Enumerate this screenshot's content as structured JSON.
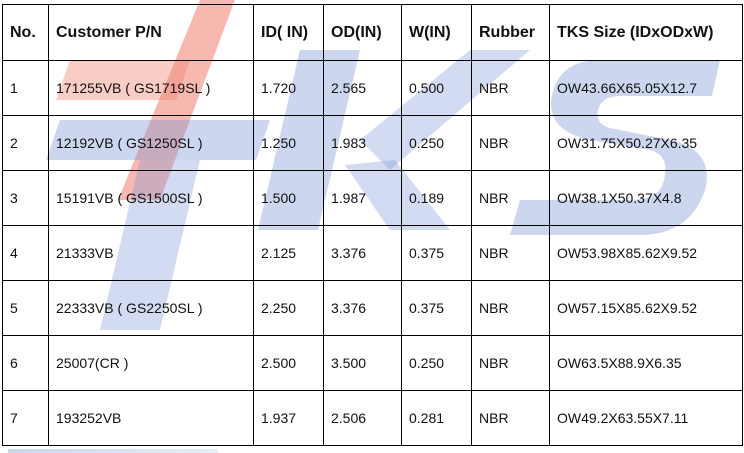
{
  "watermark": {
    "text": "TKS",
    "color_red": "#f07f6e",
    "color_blue": "#7f98d8"
  },
  "table": {
    "headers": [
      "No.",
      "Customer P/N",
      "ID( IN)",
      "OD(IN)",
      "W(IN)",
      "Rubber",
      "TKS Size (IDxODxW)"
    ],
    "rows": [
      [
        "1",
        "171255VB ( GS1719SL )",
        "1.720",
        "2.565",
        "0.500",
        "NBR",
        "OW43.66X65.05X12.7"
      ],
      [
        "2",
        "12192VB ( GS1250SL )",
        "1.250",
        "1.983",
        "0.250",
        "NBR",
        "OW31.75X50.27X6.35"
      ],
      [
        "3",
        "15191VB ( GS1500SL )",
        "1.500",
        "1.987",
        "0.189",
        "NBR",
        "OW38.1X50.37X4.8"
      ],
      [
        "4",
        "21333VB",
        "2.125",
        "3.376",
        "0.375",
        "NBR",
        "OW53.98X85.62X9.52"
      ],
      [
        "5",
        "22333VB ( GS2250SL )",
        "2.250",
        "3.376",
        "0.375",
        "NBR",
        "OW57.15X85.62X9.52"
      ],
      [
        "6",
        "25007(CR )",
        "2.500",
        "3.500",
        "0.250",
        "NBR",
        "OW63.5X88.9X6.35"
      ],
      [
        "7",
        "193252VB",
        "1.937",
        "2.506",
        "0.281",
        "NBR",
        "OW49.2X63.55X7.11"
      ]
    ]
  }
}
